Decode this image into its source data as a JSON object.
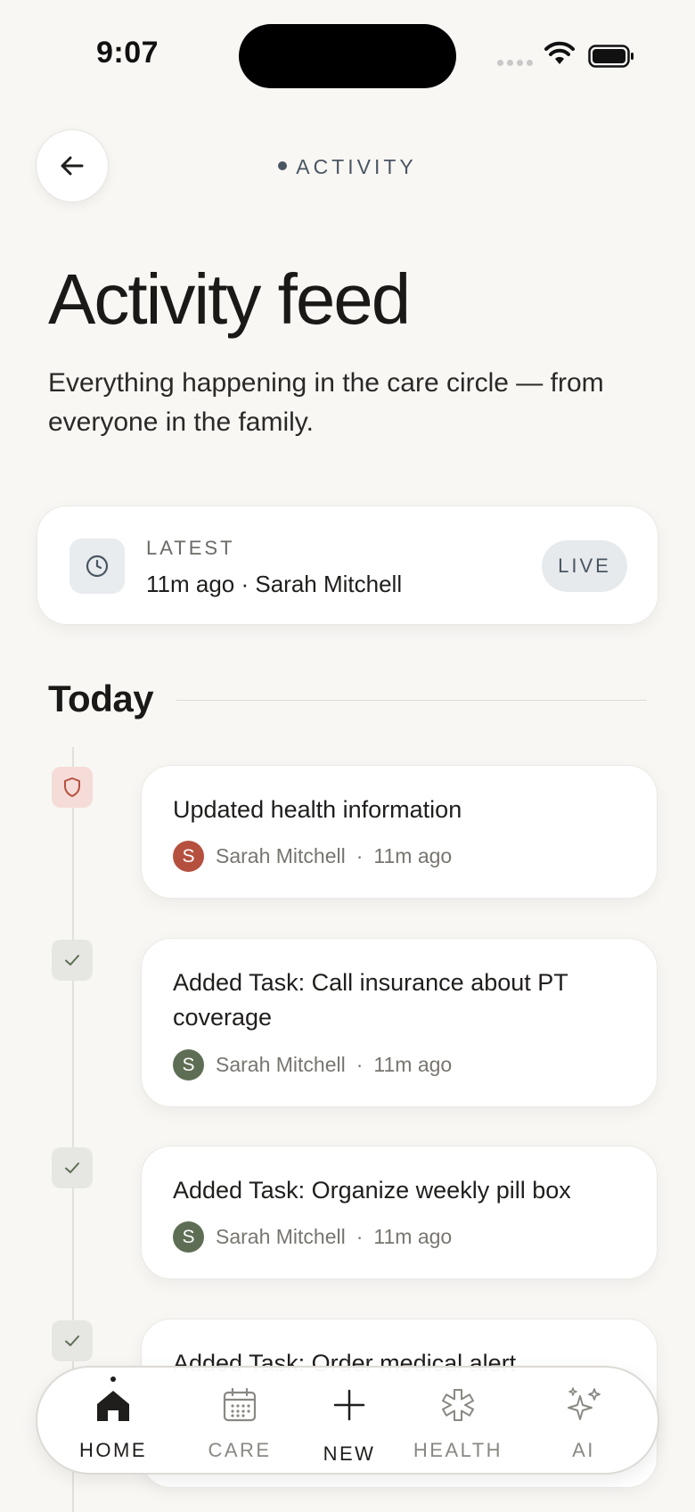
{
  "status_bar": {
    "time": "9:07"
  },
  "header": {
    "eyebrow": "ACTIVITY"
  },
  "page": {
    "title": "Activity feed",
    "subtitle": "Everything happening in the care circle — from everyone in the family."
  },
  "latest": {
    "label": "LATEST",
    "text": "11m ago · Sarah Mitchell",
    "badge": "LIVE",
    "icon": "clock-icon"
  },
  "section": {
    "title": "Today"
  },
  "feed": [
    {
      "title": "Updated health information",
      "author": "Sarah Mitchell",
      "initial": "S",
      "time": "11m ago",
      "type": "health",
      "icon": "shield-icon",
      "avatar_color": "#b5503f"
    },
    {
      "title": "Added Task: Call insurance about PT coverage",
      "author": "Sarah Mitchell",
      "initial": "S",
      "time": "11m ago",
      "type": "task",
      "icon": "check-icon",
      "avatar_color": "#5e6e55"
    },
    {
      "title": "Added Task: Organize weekly pill box",
      "author": "Sarah Mitchell",
      "initial": "S",
      "time": "11m ago",
      "type": "task",
      "icon": "check-icon",
      "avatar_color": "#5e6e55"
    },
    {
      "title": "Added Task: Order medical alert",
      "type": "task",
      "icon": "check-icon"
    }
  ],
  "nav": {
    "items": [
      {
        "label": "HOME",
        "icon": "home-icon",
        "active": true
      },
      {
        "label": "CARE",
        "icon": "calendar-icon",
        "active": false
      },
      {
        "label": "NEW",
        "icon": "plus-icon",
        "active": false
      },
      {
        "label": "HEALTH",
        "icon": "medical-star-icon",
        "active": false
      },
      {
        "label": "AI",
        "icon": "sparkles-icon",
        "active": false
      }
    ]
  },
  "colors": {
    "background": "#f8f7f4",
    "accent_slate": "#4a5562",
    "health_red": "#b5503f",
    "task_green": "#5e6e55"
  }
}
